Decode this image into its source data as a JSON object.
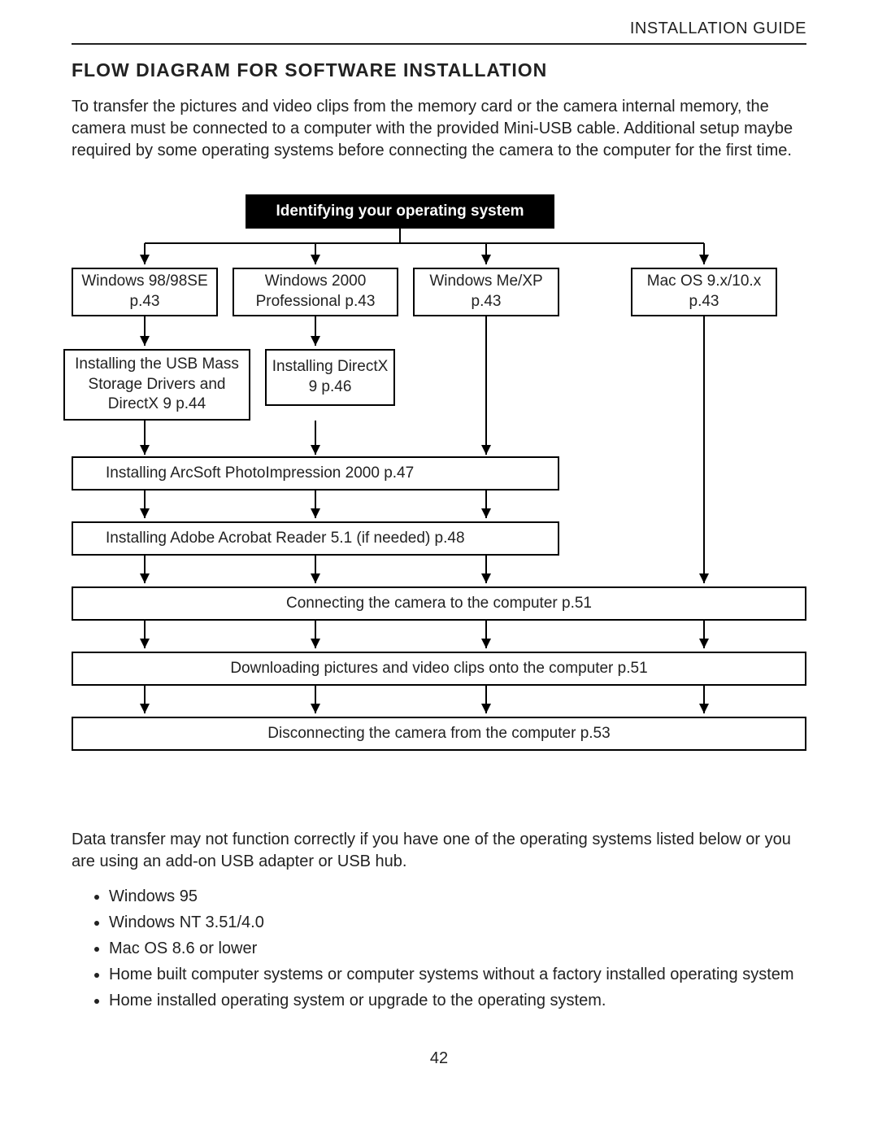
{
  "header": {
    "doc_label": "INSTALLATION GUIDE"
  },
  "title": "FLOW DIAGRAM FOR SOFTWARE INSTALLATION",
  "intro": "To transfer the pictures and video clips from the memory card or the camera internal memory, the camera must be connected to a computer with the provided Mini-USB cable.  Additional setup maybe required by some operating systems before connecting the camera to the computer for the first time.",
  "diagram": {
    "root": "Identifying your operating system",
    "os_boxes": [
      "Windows 98/98SE p.43",
      "Windows 2000 Professional p.43",
      "Windows Me/XP p.43",
      "Mac OS 9.x/10.x p.43"
    ],
    "stage2_boxes": [
      "Installing the USB Mass Storage Drivers and DirectX 9 p.44",
      "Installing DirectX 9 p.46"
    ],
    "wide_boxes": [
      "Installing ArcSoft PhotoImpression 2000 p.47",
      "Installing  Adobe Acrobat Reader 5.1 (if needed) p.48",
      "Connecting the camera to the computer p.51",
      "Downloading pictures and video clips onto the computer p.51",
      "Disconnecting the camera from the computer p.53"
    ]
  },
  "outro": "Data transfer may not function correctly if you have one of the operating systems listed below or you are using an add-on USB adapter or USB hub.",
  "notes": [
    "Windows 95",
    "Windows NT 3.51/4.0",
    "Mac OS 8.6 or lower",
    "Home built computer systems or computer systems without a factory installed operating system",
    "Home installed operating system or upgrade to the operating system."
  ],
  "page_number": "42"
}
